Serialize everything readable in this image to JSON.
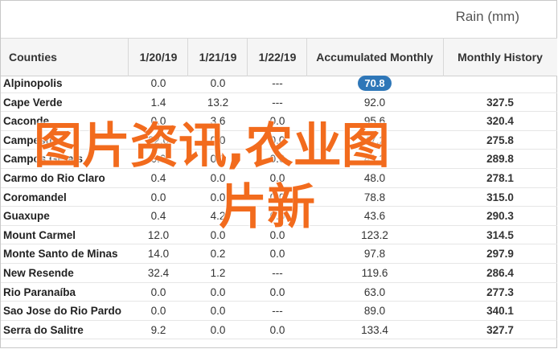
{
  "unit_label": "Rain (mm)",
  "columns": [
    "Counties",
    "1/20/19",
    "1/21/19",
    "1/22/19",
    "Accumulated Monthly",
    "Monthly History"
  ],
  "rows": [
    {
      "name": "Alpinopolis",
      "d1": "0.0",
      "d2": "0.0",
      "d3": "---",
      "acc": "70.8",
      "hist": ""
    },
    {
      "name": "Cape Verde",
      "d1": "1.4",
      "d2": "13.2",
      "d3": "---",
      "acc": "92.0",
      "hist": "327.5"
    },
    {
      "name": "Caconde",
      "d1": "0.0",
      "d2": "3.6",
      "d3": "0.0",
      "acc": "95.6",
      "hist": "320.4"
    },
    {
      "name": "Campestre",
      "d1": "22.0",
      "d2": "0.0",
      "d3": "0.0",
      "acc": "47.2",
      "hist": "275.8"
    },
    {
      "name": "Campos Gerais",
      "d1": "0.0",
      "d2": "0.0",
      "d3": "0.0",
      "acc": "41.2",
      "hist": "289.8"
    },
    {
      "name": "Carmo do Rio Claro",
      "d1": "0.4",
      "d2": "0.0",
      "d3": "0.0",
      "acc": "48.0",
      "hist": "278.1"
    },
    {
      "name": "Coromandel",
      "d1": "0.0",
      "d2": "0.0",
      "d3": "0.0",
      "acc": "78.8",
      "hist": "315.0"
    },
    {
      "name": "Guaxupe",
      "d1": "0.4",
      "d2": "4.2",
      "d3": "0.0",
      "acc": "43.6",
      "hist": "290.3"
    },
    {
      "name": "Mount Carmel",
      "d1": "12.0",
      "d2": "0.0",
      "d3": "0.0",
      "acc": "123.2",
      "hist": "314.5"
    },
    {
      "name": "Monte Santo de Minas",
      "d1": "14.0",
      "d2": "0.2",
      "d3": "0.0",
      "acc": "97.8",
      "hist": "297.9"
    },
    {
      "name": "New Resende",
      "d1": "32.4",
      "d2": "1.2",
      "d3": "---",
      "acc": "119.6",
      "hist": "286.4"
    },
    {
      "name": "Rio Paranaíba",
      "d1": "0.0",
      "d2": "0.0",
      "d3": "0.0",
      "acc": "63.0",
      "hist": "277.3"
    },
    {
      "name": "Sao Jose do Rio Pardo",
      "d1": "0.0",
      "d2": "0.0",
      "d3": "---",
      "acc": "89.0",
      "hist": "340.1"
    },
    {
      "name": "Serra do Salitre",
      "d1": "9.2",
      "d2": "0.0",
      "d3": "0.0",
      "acc": "133.4",
      "hist": "327.7"
    }
  ],
  "watermark": {
    "line1": "图片资讯,农业图",
    "line2": "片新",
    "color": "#f26b1d"
  }
}
